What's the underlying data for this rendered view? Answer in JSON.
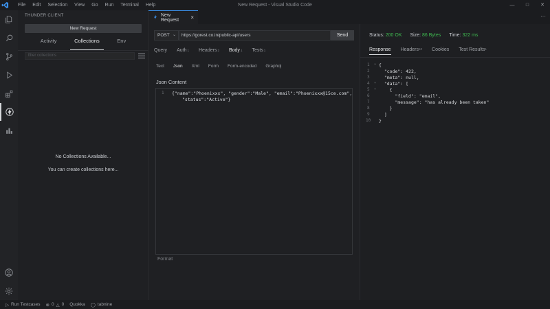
{
  "window": {
    "title": "New Request - Visual Studio Code",
    "menu": [
      "File",
      "Edit",
      "Selection",
      "View",
      "Go",
      "Run",
      "Terminal",
      "Help"
    ]
  },
  "activity_bar": {
    "icons": [
      "explorer-icon",
      "search-icon",
      "source-control-icon",
      "run-debug-icon",
      "extensions-icon",
      "thunder-client-icon",
      "chart-icon",
      "account-icon",
      "settings-icon"
    ]
  },
  "sidebar": {
    "title": "THUNDER CLIENT",
    "new_request_label": "New Request",
    "tabs": [
      "Activity",
      "Collections",
      "Env"
    ],
    "active_tab": "Collections",
    "filter_placeholder": "filter collections",
    "empty_title": "No Collections Available...",
    "empty_hint": "You can create collections here..."
  },
  "editor_tab": {
    "label": "New Request"
  },
  "request": {
    "method": "POST",
    "url": "https://gorest.co.in/public-api/users",
    "send_label": "Send",
    "tabs": [
      {
        "label": "Query",
        "count": ""
      },
      {
        "label": "Auth",
        "count": "1"
      },
      {
        "label": "Headers",
        "count": "2"
      },
      {
        "label": "Body",
        "count": "1"
      },
      {
        "label": "Tests",
        "count": "1"
      }
    ],
    "active_tab": "Body",
    "body_tabs": [
      "Text",
      "Json",
      "Xml",
      "Form",
      "Form-encoded",
      "Graphql"
    ],
    "active_body_tab": "Json",
    "json_label": "Json Content",
    "body_line_1": "{\"name\":\"Phoenixxx\", \"gender\":\"Male\", \"email\":\"Phoenixxx@15ce.com\",",
    "body_line_2": "\"status\":\"Active\"}",
    "format_label": "Format"
  },
  "response": {
    "status_label": "Status:",
    "status_value": "200 OK",
    "size_label": "Size:",
    "size_value": "86 Bytes",
    "time_label": "Time:",
    "time_value": "322 ms",
    "tabs": [
      {
        "label": "Response",
        "count": ""
      },
      {
        "label": "Headers",
        "count": "10"
      },
      {
        "label": "Cookies",
        "count": ""
      },
      {
        "label": "Test Results",
        "count": "1"
      }
    ],
    "active_tab": "Response",
    "lines": [
      "{",
      "  \"code\": 422,",
      "  \"meta\": null,",
      "  \"data\": [",
      "    {",
      "      \"field\": \"email\",",
      "      \"message\": \"has already been taken\"",
      "    }",
      "  ]",
      "}"
    ]
  },
  "statusbar": {
    "run_testcases": "Run Testcases",
    "errors": "0",
    "warnings": "0",
    "quokka": "Quokka",
    "tabnine": "tabnine"
  }
}
